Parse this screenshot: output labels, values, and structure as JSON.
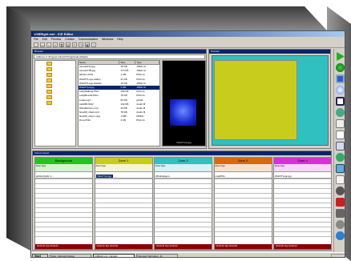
{
  "window": {
    "title": "1OBRight.xml - ICE Editor",
    "menu": [
      "File",
      "Edit",
      "Preview",
      "Creator",
      "Communication",
      "Windows",
      "Help"
    ],
    "toolbar_icons": [
      "new-icon",
      "open-icon",
      "save-icon",
      "cut-icon",
      "copy-icon",
      "paste-icon",
      "undo-icon",
      "redo-icon",
      "print-icon",
      "help-icon"
    ]
  },
  "browser": {
    "title": "Browser",
    "address_label": "Address",
    "address": "C:\\Program Files\\NTI\\Application\\Media",
    "tree_items": 8,
    "columns": [
      "Name",
      "Size",
      "Type"
    ],
    "files": [
      {
        "name": "canvasP14.jpg",
        "size": "46 KB",
        "type": "JPEG Im"
      },
      {
        "name": "canvasTTB.jpg",
        "size": "174 KB",
        "type": "JPEG Im"
      },
      {
        "name": "attrition.PNG",
        "size": "1 KB",
        "type": "PNG Im"
      },
      {
        "name": "WHATTLogo.wallon",
        "size": "21 KB",
        "type": "PNG Im"
      },
      {
        "name": "WHATTLogo.Hawkie",
        "size": "16 KB",
        "type": "JPEG Im"
      },
      {
        "name": "WHATTpd.jpg",
        "size": "3 KB",
        "type": "JPEG Im"
      },
      {
        "name": "LadyWalking.PNG",
        "size": "196 KB",
        "type": "PNG Im"
      },
      {
        "name": "LadyBlueTel.PNG",
        "size": "76 KB",
        "type": "PNG Im"
      },
      {
        "name": "Lisanet.gif",
        "size": "65 KB",
        "type": "gif Me"
      },
      {
        "name": "LEAMR.WAV",
        "size": "102 KB",
        "type": "Audio M"
      },
      {
        "name": "WaveButtons.mid",
        "size": "29 KB",
        "type": "Audio M"
      },
      {
        "name": "Newhill_shad.mp3",
        "size": "78 KB",
        "type": "Audio M"
      },
      {
        "name": "Newhill_shuyn.mpg",
        "size": "1 MB",
        "type": "MPEG"
      },
      {
        "name": "Drop.PNG",
        "size": "2 KB",
        "type": "PNG Im"
      }
    ],
    "selected_index": 5,
    "thumbnail_caption": "WHATTpd.jpg"
  },
  "preview": {
    "title": "Preview"
  },
  "zones": {
    "title": "Zones Layout",
    "columns": [
      {
        "name": "Background",
        "color": "#22c322",
        "file": "attrition(light) m...",
        "highlight": false
      },
      {
        "name": "Zone 1",
        "color": "#c8cc1c",
        "file": "WHATTpd.jpg",
        "highlight": true
      },
      {
        "name": "Zone 2",
        "color": "#30c0c0",
        "file": "Whattnalogon...",
        "highlight": false
      },
      {
        "name": "Zone 3",
        "color": "#d86a0c",
        "file": "mastPNG",
        "highlight": false
      },
      {
        "name": "Zone 4",
        "color": "#d830d8",
        "file": "WHATTLogo.jpg",
        "highlight": false
      }
    ],
    "control_labels": [
      "Zone",
      "Type"
    ],
    "footer_text": "00:00:00  1fps  00:00:00"
  },
  "taskbar": {
    "start_label": "Start",
    "tasks": [
      {
        "label": "Inbox - Microsoft Outlook",
        "active": false
      },
      {
        "label": "1OBRight.xml - ICE Edit...",
        "active": true
      },
      {
        "label": "Document Technology - M...",
        "active": false
      }
    ]
  },
  "colors": {
    "title_bar": "#0a246a",
    "preview_bg": "#30c0c0",
    "preview_inner": "#c8cc1c",
    "zone_footer": "#8b0000"
  }
}
